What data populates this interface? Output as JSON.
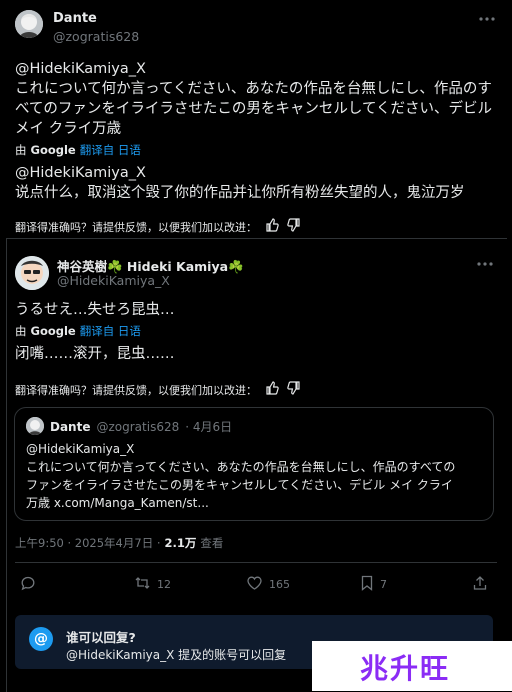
{
  "tweet1": {
    "name": "Dante",
    "handle": "@zogratis628",
    "line1": "@HidekiKamiya_X",
    "line2": "これについて何か言ってください、あなたの作品を台無しにし、作品のす",
    "line3": "べてのファンをイライラさせたこの男をキャンセルしてください、デビル",
    "line4": "メイ クライ万歳",
    "by": "由",
    "google": "Google",
    "translated_from": "翻译自 日语",
    "trans1": "@HidekiKamiya_X",
    "trans2": "说点什么，取消这个毁了你的作品并让你所有粉丝失望的人，鬼泣万岁",
    "feedback": "翻译得准确吗？请提供反馈，以便我们加以改进："
  },
  "tweet2": {
    "name": "神谷英樹☘️ Hideki Kamiya☘️",
    "handle": "@HidekiKamiya_X",
    "text": "うるせえ…失せろ昆虫…",
    "by": "由",
    "google": "Google",
    "translated_from": "翻译自 日语",
    "trans": "闭嘴……滚开，昆虫……",
    "feedback": "翻译得准确吗？请提供反馈，以便我们加以改进："
  },
  "quote": {
    "name": "Dante",
    "handle": "@zogratis628",
    "date": "· 4月6日",
    "line1": "@HidekiKamiya_X",
    "line2": "これについて何か言ってください、あなたの作品を台無しにし、作品のすべての",
    "line3": "ファンをイライラさせたこの男をキャンセルしてください、デビル メイ クライ",
    "line4": "万歳 x.com/Manga_Kamen/st..."
  },
  "meta": {
    "time": "上午9:50 · 2025年4月7日 ·",
    "views": "2.1万",
    "views_label": "查看"
  },
  "actions": {
    "retweets": "12",
    "likes": "165",
    "bookmarks": "7"
  },
  "reply_box": {
    "title": "谁可以回复?",
    "desc": "@HidekiKamiya_X 提及的账号可以回复"
  },
  "watermark": {
    "text": "兆升旺"
  }
}
